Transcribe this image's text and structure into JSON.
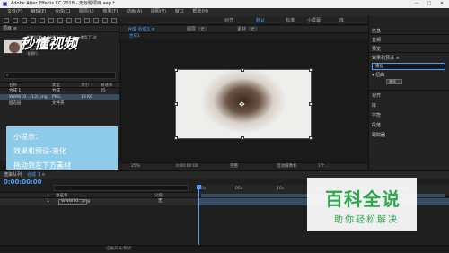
{
  "title_bar": {
    "title": "Adobe After Effects CC 2018 - 无标题项目.aep *",
    "minimize": "—",
    "maximize": "□",
    "close": "✕"
  },
  "menu": [
    "文件(F)",
    "编辑(E)",
    "合成(C)",
    "图层(L)",
    "效果(T)",
    "动画(A)",
    "视图(V)",
    "窗口",
    "帮助(H)"
  ],
  "workspaces": {
    "align": "对齐",
    "default": "默认",
    "standard": "标准",
    "small_screen": "小屏幕",
    "libraries": "库"
  },
  "project": {
    "panel_title": "项目 ≡",
    "asset_meta": [
      "WWW10...-64K58 (13).png ▾, 使用了1次",
      "256 x 165 (1.00)",
      "数百万种颜色",
      "非隔行"
    ],
    "columns": {
      "name": "名称",
      "type": "类型",
      "size": "大小",
      "rate": "帧速率"
    },
    "rows": [
      {
        "name": "合成 1",
        "type": "合成",
        "size": "",
        "rate": "25"
      },
      {
        "name": "WWW10...(13).png",
        "type": "PNG",
        "size": "18 KB",
        "rate": ""
      },
      {
        "name": "固态层",
        "type": "文件夹",
        "size": "",
        "rate": ""
      }
    ]
  },
  "watermark_tl": "秒懂视频",
  "tip": {
    "line1": "小提示：",
    "line2": "效果和预设-液化",
    "line3": "拖动到左下方素材"
  },
  "composition": {
    "tab_comp": "合成 合成1 ≡",
    "tab_layer": "图层（无）",
    "tab_footage": "素材（无）",
    "sub_tab": "合成1",
    "zoom": "25%",
    "time": "0:00:00:00",
    "resolution": "完整",
    "camera": "活动摄像机",
    "views": "1个..."
  },
  "right_panel": {
    "items_top": [
      "信息",
      "音频",
      "预览"
    ],
    "effects_title": "效果和预设 ≡",
    "search_value": "液化",
    "group": "▾ 扭曲",
    "fx_label": "液化",
    "items_bottom": [
      "对齐",
      "库",
      "字符",
      "段落",
      "跟踪器"
    ]
  },
  "timeline": {
    "tab_render": "渲染队列",
    "tab_comp": "合成 1 ≡",
    "timecode": "0:00:00:00",
    "col_source": "源名称",
    "col_mode": "父级",
    "layer_index": "1",
    "layer_name": "WWW10...png",
    "parent_value": "无",
    "ruler_marks": [
      "0s",
      "05s",
      "10s",
      "15s",
      "20s",
      "25s"
    ],
    "footer": "切换开关/模式"
  },
  "baike": {
    "main": "百科全说",
    "sub": "助你轻松解决"
  },
  "colors": {
    "accent": "#4ba0ff",
    "tip_bg": "#8ecbe9",
    "baike_green": "#2aa84a"
  }
}
